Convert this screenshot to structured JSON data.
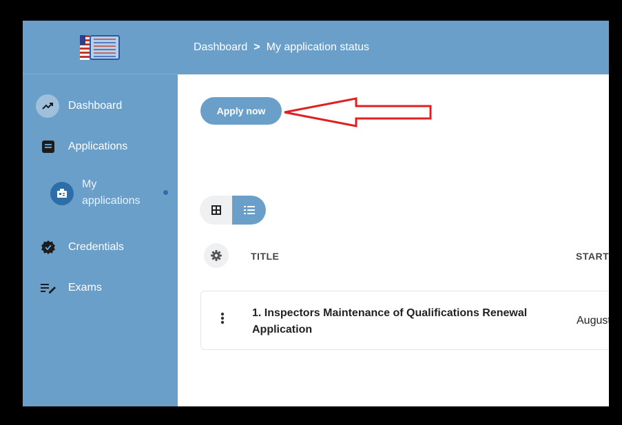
{
  "sidebar": {
    "logo_name": "logo",
    "items": [
      {
        "label": "Dashboard",
        "icon": "trending-up-icon"
      },
      {
        "label": "Applications",
        "icon": "document-icon"
      },
      {
        "label": "My applications",
        "icon": "id-card-icon"
      },
      {
        "label": "Credentials",
        "icon": "verified-badge-icon"
      },
      {
        "label": "Exams",
        "icon": "edit-list-icon"
      }
    ]
  },
  "header": {
    "breadcrumb": [
      "Dashboard",
      "My application status"
    ],
    "separator": ">"
  },
  "main": {
    "apply_button": "Apply now",
    "view_toggle": {
      "grid_icon": "grid-icon",
      "list_icon": "list-icon",
      "active": "list"
    },
    "table": {
      "settings_icon": "gear-icon",
      "columns": [
        "TITLE",
        "STARTI"
      ],
      "rows": [
        {
          "title": "1. Inspectors Maintenance of Qualifications Renewal Application",
          "started": "August"
        }
      ]
    }
  },
  "annotation": {
    "type": "red-arrow",
    "color": "#e02020"
  },
  "colors": {
    "accent": "#6a9fca",
    "accent_dark": "#2c6fa8",
    "frame": "#000000"
  }
}
